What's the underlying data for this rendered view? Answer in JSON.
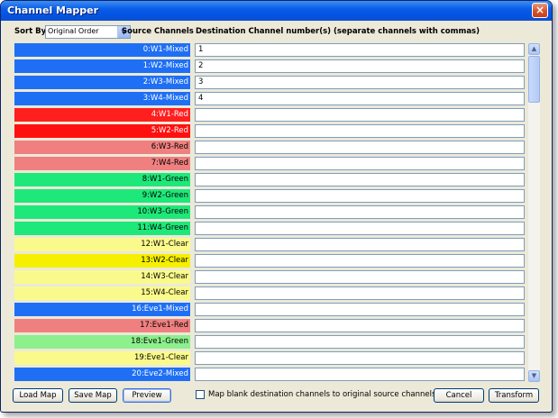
{
  "window": {
    "title": "Channel Mapper",
    "close_glyph": "×"
  },
  "sort": {
    "label": "Sort By:",
    "value": "Original Order"
  },
  "headers": {
    "source": "Source Channels",
    "destination": "Destination Channel number(s) (separate channels with commas)"
  },
  "channels": [
    {
      "source": "0:W1-Mixed",
      "dest": "1",
      "color": "#1f6ff5",
      "text_color": "#ffffff"
    },
    {
      "source": "1:W2-Mixed",
      "dest": "2",
      "color": "#1f6ff5",
      "text_color": "#ffffff"
    },
    {
      "source": "2:W3-Mixed",
      "dest": "3",
      "color": "#1f6ff5",
      "text_color": "#ffffff"
    },
    {
      "source": "3:W4-Mixed",
      "dest": "4",
      "color": "#1f6ff5",
      "text_color": "#ffffff"
    },
    {
      "source": "4:W1-Red",
      "dest": "",
      "color": "#ff1f1f",
      "text_color": "#ffffff"
    },
    {
      "source": "5:W2-Red",
      "dest": "",
      "color": "#ff1010",
      "text_color": "#ffffff"
    },
    {
      "source": "6:W3-Red",
      "dest": "",
      "color": "#f08080",
      "text_color": "#000000"
    },
    {
      "source": "7:W4-Red",
      "dest": "",
      "color": "#f08080",
      "text_color": "#000000"
    },
    {
      "source": "8:W1-Green",
      "dest": "",
      "color": "#1ee87a",
      "text_color": "#000000"
    },
    {
      "source": "9:W2-Green",
      "dest": "",
      "color": "#1ee87a",
      "text_color": "#000000"
    },
    {
      "source": "10:W3-Green",
      "dest": "",
      "color": "#1ee87a",
      "text_color": "#000000"
    },
    {
      "source": "11:W4-Green",
      "dest": "",
      "color": "#1ee87a",
      "text_color": "#000000"
    },
    {
      "source": "12:W1-Clear",
      "dest": "",
      "color": "#fafa8c",
      "text_color": "#000000"
    },
    {
      "source": "13:W2-Clear",
      "dest": "",
      "color": "#f5ef00",
      "text_color": "#000000"
    },
    {
      "source": "14:W3-Clear",
      "dest": "",
      "color": "#fafa8c",
      "text_color": "#000000"
    },
    {
      "source": "15:W4-Clear",
      "dest": "",
      "color": "#fafa8c",
      "text_color": "#000000"
    },
    {
      "source": "16:Eve1-Mixed",
      "dest": "",
      "color": "#1f6ff5",
      "text_color": "#ffffff"
    },
    {
      "source": "17:Eve1-Red",
      "dest": "",
      "color": "#f08080",
      "text_color": "#000000"
    },
    {
      "source": "18:Eve1-Green",
      "dest": "",
      "color": "#8cf08c",
      "text_color": "#000000"
    },
    {
      "source": "19:Eve1-Clear",
      "dest": "",
      "color": "#fafa8c",
      "text_color": "#000000"
    },
    {
      "source": "20:Eve2-Mixed",
      "dest": "",
      "color": "#1f6ff5",
      "text_color": "#ffffff"
    }
  ],
  "scrollbar": {
    "up_glyph": "▲",
    "down_glyph": "▼"
  },
  "buttons": {
    "load_map": "Load Map",
    "save_map": "Save Map",
    "preview": "Preview",
    "cancel": "Cancel",
    "transform": "Transform"
  },
  "option": {
    "label": "Map blank destination channels to original source channels.",
    "checked": false
  }
}
